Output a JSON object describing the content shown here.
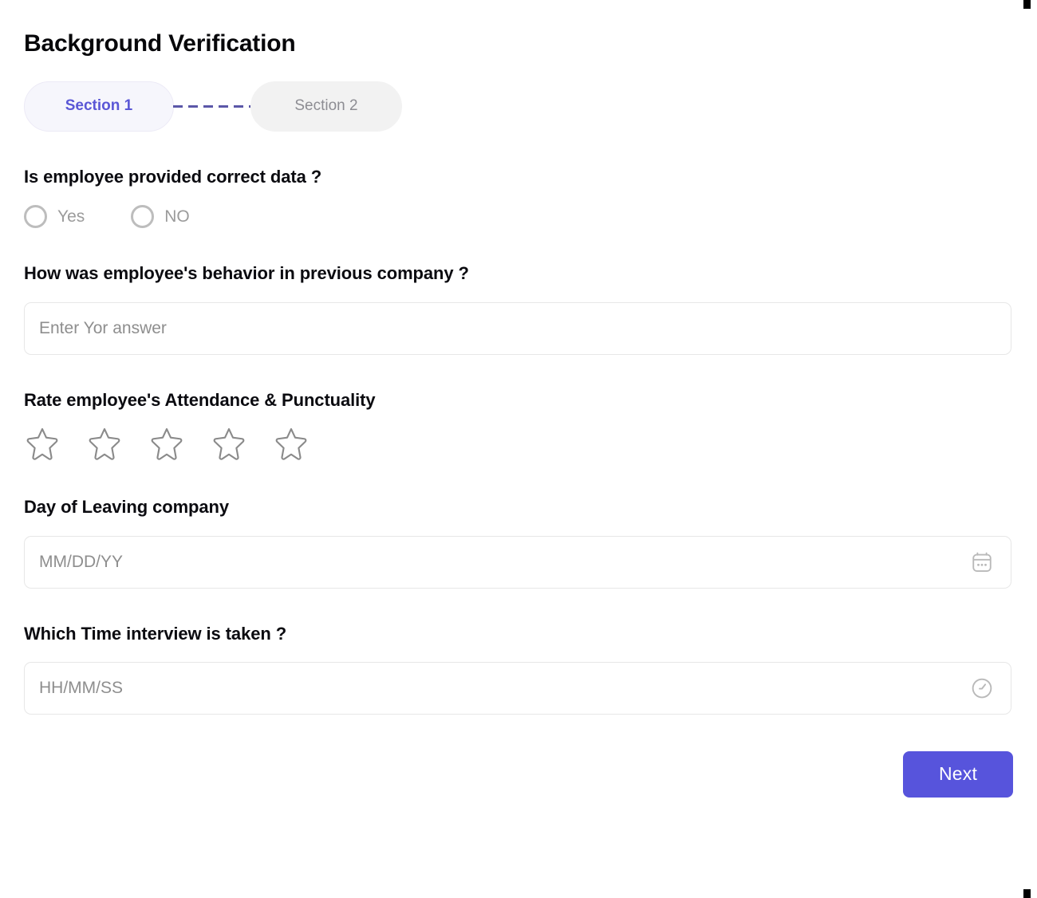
{
  "page": {
    "title": "Background Verification",
    "accent_color": "#5754dc",
    "active_pill_bg": "#f6f6fc",
    "inactive_pill_bg": "#f2f2f2",
    "connector_color": "#5b57a8"
  },
  "stepper": {
    "steps": [
      {
        "label": "Section 1",
        "state": "active"
      },
      {
        "label": "Section 2",
        "state": "inactive"
      }
    ],
    "connector": "dashed-line"
  },
  "questions": {
    "correct_data": {
      "label": "Is employee provided correct data ?",
      "options": [
        {
          "label": "Yes",
          "selected": false
        },
        {
          "label": "NO",
          "selected": false
        }
      ]
    },
    "behavior": {
      "label": "How was employee's behavior in previous company ?",
      "placeholder": "Enter Yor answer",
      "value": ""
    },
    "rating": {
      "label": "Rate employee's Attendance & Punctuality",
      "max": 5,
      "value": 0,
      "stars": [
        "star-1",
        "star-2",
        "star-3",
        "star-4",
        "star-5"
      ]
    },
    "leaving_date": {
      "label": "Day of Leaving company",
      "placeholder": "MM/DD/YY",
      "value": "",
      "icon": "calendar-icon"
    },
    "interview_time": {
      "label": "Which Time interview is taken ?",
      "placeholder": "HH/MM/SS",
      "value": "",
      "icon": "clock-icon"
    }
  },
  "footer": {
    "next_label": "Next"
  }
}
